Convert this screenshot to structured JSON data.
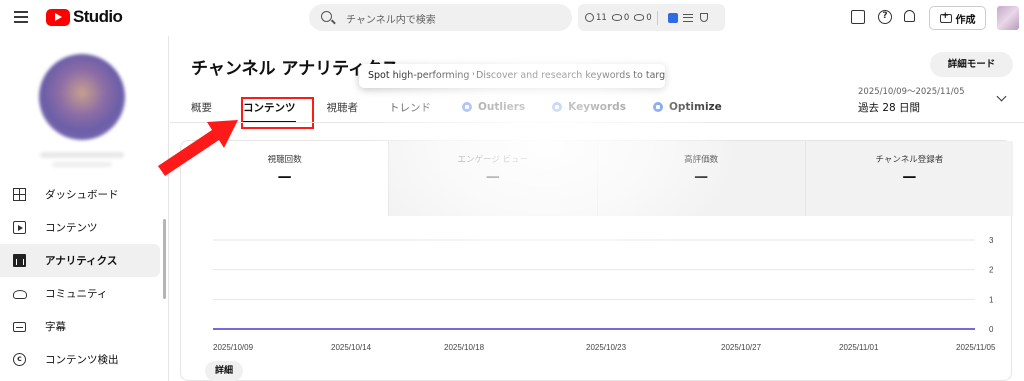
{
  "topbar": {
    "app_name": "Studio",
    "search_placeholder": "チャンネル内で検索",
    "stats": {
      "watch": "11",
      "views": "0",
      "eye": "0"
    },
    "create_label": "作成"
  },
  "sidebar": {
    "items": [
      {
        "label": "ダッシュボード",
        "icon": "dashboard-icon"
      },
      {
        "label": "コンテンツ",
        "icon": "content-icon"
      },
      {
        "label": "アナリティクス",
        "icon": "analytics-icon",
        "active": true
      },
      {
        "label": "コミュニティ",
        "icon": "community-icon"
      },
      {
        "label": "字幕",
        "icon": "subtitles-icon"
      },
      {
        "label": "コンテンツ検出",
        "icon": "copyright-icon"
      }
    ]
  },
  "main": {
    "title": "チャンネル アナリティクス",
    "tooltip": {
      "left": "Spot high-performing vide",
      "right": "Discover and research keywords to target"
    },
    "detail_mode_label": "詳細モード",
    "date_range": {
      "dates": "2025/10/09〜2025/11/05",
      "label": "過去 28 日間"
    },
    "tabs": [
      {
        "label": "概要"
      },
      {
        "label": "コンテンツ",
        "active": true
      },
      {
        "label": "視聴者"
      },
      {
        "label": "トレンド"
      },
      {
        "label": "Outliers",
        "extension": true
      },
      {
        "label": "Keywords",
        "extension": true
      },
      {
        "label": "Optimize",
        "extension": true
      }
    ],
    "metrics": [
      {
        "label": "視聴回数",
        "value": "—"
      },
      {
        "label": "エンゲージ ビュー",
        "value": "—"
      },
      {
        "label": "高評価数",
        "value": "—"
      },
      {
        "label": "チャンネル登録者",
        "value": "—"
      }
    ],
    "more_label": "詳細"
  },
  "chart_data": {
    "type": "line",
    "x": [
      "2025/10/09",
      "2025/10/14",
      "2025/10/18",
      "2025/10/23",
      "2025/10/27",
      "2025/11/01",
      "2025/11/05"
    ],
    "y_ticks": [
      "3",
      "2",
      "1",
      "0"
    ],
    "ylim": [
      0,
      3
    ],
    "series": [
      {
        "values": [
          0,
          0,
          0,
          0,
          0,
          0,
          0
        ],
        "color": "#7b68d8"
      }
    ],
    "grid": true
  },
  "annotation": {
    "arrow_color": "#ff1a1a"
  }
}
